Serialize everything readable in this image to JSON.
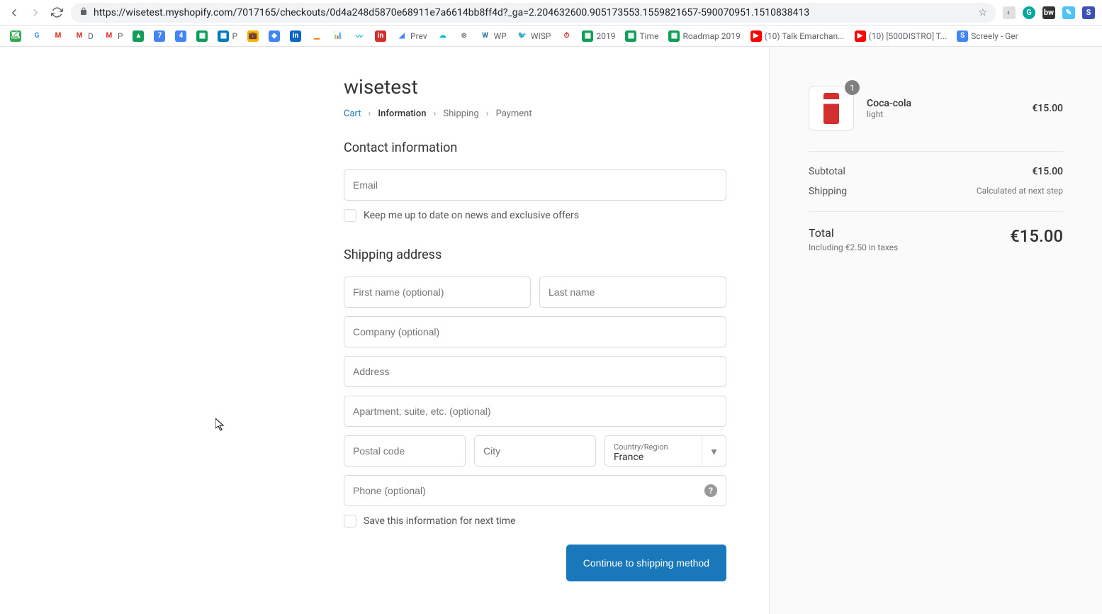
{
  "browser": {
    "url": "https://wisetest.myshopify.com/7017165/checkouts/0d4a248d5870e68911e7a6614bb8ff4d?_ga=2.204632600.905173553.1559821657-590070951.1510838413",
    "bookmarks": [
      {
        "label": "",
        "color": "#34a853",
        "text": "🗺"
      },
      {
        "label": "",
        "color": "#fff",
        "text": "G",
        "tc": "#4285f4"
      },
      {
        "label": "",
        "color": "#fff",
        "text": "M",
        "tc": "#d93025"
      },
      {
        "label": "D",
        "color": "#fff",
        "text": "M",
        "tc": "#d93025"
      },
      {
        "label": "P",
        "color": "#fff",
        "text": "M",
        "tc": "#d93025"
      },
      {
        "label": "",
        "color": "#0f9d58",
        "text": "▲"
      },
      {
        "label": "",
        "color": "#4285f4",
        "text": "7"
      },
      {
        "label": "",
        "color": "#4285f4",
        "text": "4"
      },
      {
        "label": "",
        "color": "#0f9d58",
        "text": "▦"
      },
      {
        "label": "P",
        "color": "#0079bf",
        "text": "▦"
      },
      {
        "label": "",
        "color": "#f4b400",
        "text": "💼"
      },
      {
        "label": "",
        "color": "#4285f4",
        "text": "◆"
      },
      {
        "label": "",
        "color": "#0a66c2",
        "text": "in"
      },
      {
        "label": "",
        "color": "#fff",
        "text": "▁",
        "tc": "#f57c00"
      },
      {
        "label": "",
        "color": "#fff",
        "text": "📊",
        "tc": "#f57c00"
      },
      {
        "label": "",
        "color": "#fff",
        "text": "〰",
        "tc": "#00bcd4"
      },
      {
        "label": "",
        "color": "#d32f2f",
        "text": "in"
      },
      {
        "label": "Prev",
        "color": "#fff",
        "text": "◢",
        "tc": "#4285f4"
      },
      {
        "label": "",
        "color": "#fff",
        "text": "☁",
        "tc": "#00bcd4"
      },
      {
        "label": "",
        "color": "#fff",
        "text": "⊛",
        "tc": "#888"
      },
      {
        "label": "WP",
        "color": "#fff",
        "text": "W",
        "tc": "#21759b"
      },
      {
        "label": "WISP",
        "color": "#fff",
        "text": "🐦",
        "tc": "#29b6f6"
      },
      {
        "label": "",
        "color": "#fff",
        "text": "⏱",
        "tc": "#d32f2f"
      },
      {
        "label": "2019",
        "color": "#0f9d58",
        "text": "▦"
      },
      {
        "label": "Time",
        "color": "#0f9d58",
        "text": "▦"
      },
      {
        "label": "Roadmap 2019",
        "color": "#0f9d58",
        "text": "▦"
      },
      {
        "label": "(10) Talk Emarchan...",
        "color": "#ff0000",
        "text": "▶"
      },
      {
        "label": "(10) [500DISTRO] T...",
        "color": "#ff0000",
        "text": "▶"
      },
      {
        "label": "Screely - Ger",
        "color": "#4285f4",
        "text": "S"
      }
    ]
  },
  "store": {
    "name": "wisetest"
  },
  "breadcrumbs": {
    "cart": "Cart",
    "information": "Information",
    "shipping": "Shipping",
    "payment": "Payment"
  },
  "contact": {
    "heading": "Contact information",
    "email_placeholder": "Email",
    "newsletter_label": "Keep me up to date on news and exclusive offers"
  },
  "shipping": {
    "heading": "Shipping address",
    "first_name_placeholder": "First name (optional)",
    "last_name_placeholder": "Last name",
    "company_placeholder": "Company (optional)",
    "address_placeholder": "Address",
    "apt_placeholder": "Apartment, suite, etc. (optional)",
    "postal_placeholder": "Postal code",
    "city_placeholder": "City",
    "country_label": "Country/Region",
    "country_value": "France",
    "phone_placeholder": "Phone (optional)",
    "save_label": "Save this information for next time"
  },
  "actions": {
    "continue": "Continue to shipping method"
  },
  "cart": {
    "item": {
      "name": "Coca-cola",
      "variant": "light",
      "price": "€15.00",
      "qty": "1"
    },
    "subtotal_label": "Subtotal",
    "subtotal_value": "€15.00",
    "shipping_label": "Shipping",
    "shipping_value": "Calculated at next step",
    "total_label": "Total",
    "total_value": "€15.00",
    "tax_note": "Including €2.50 in taxes"
  }
}
